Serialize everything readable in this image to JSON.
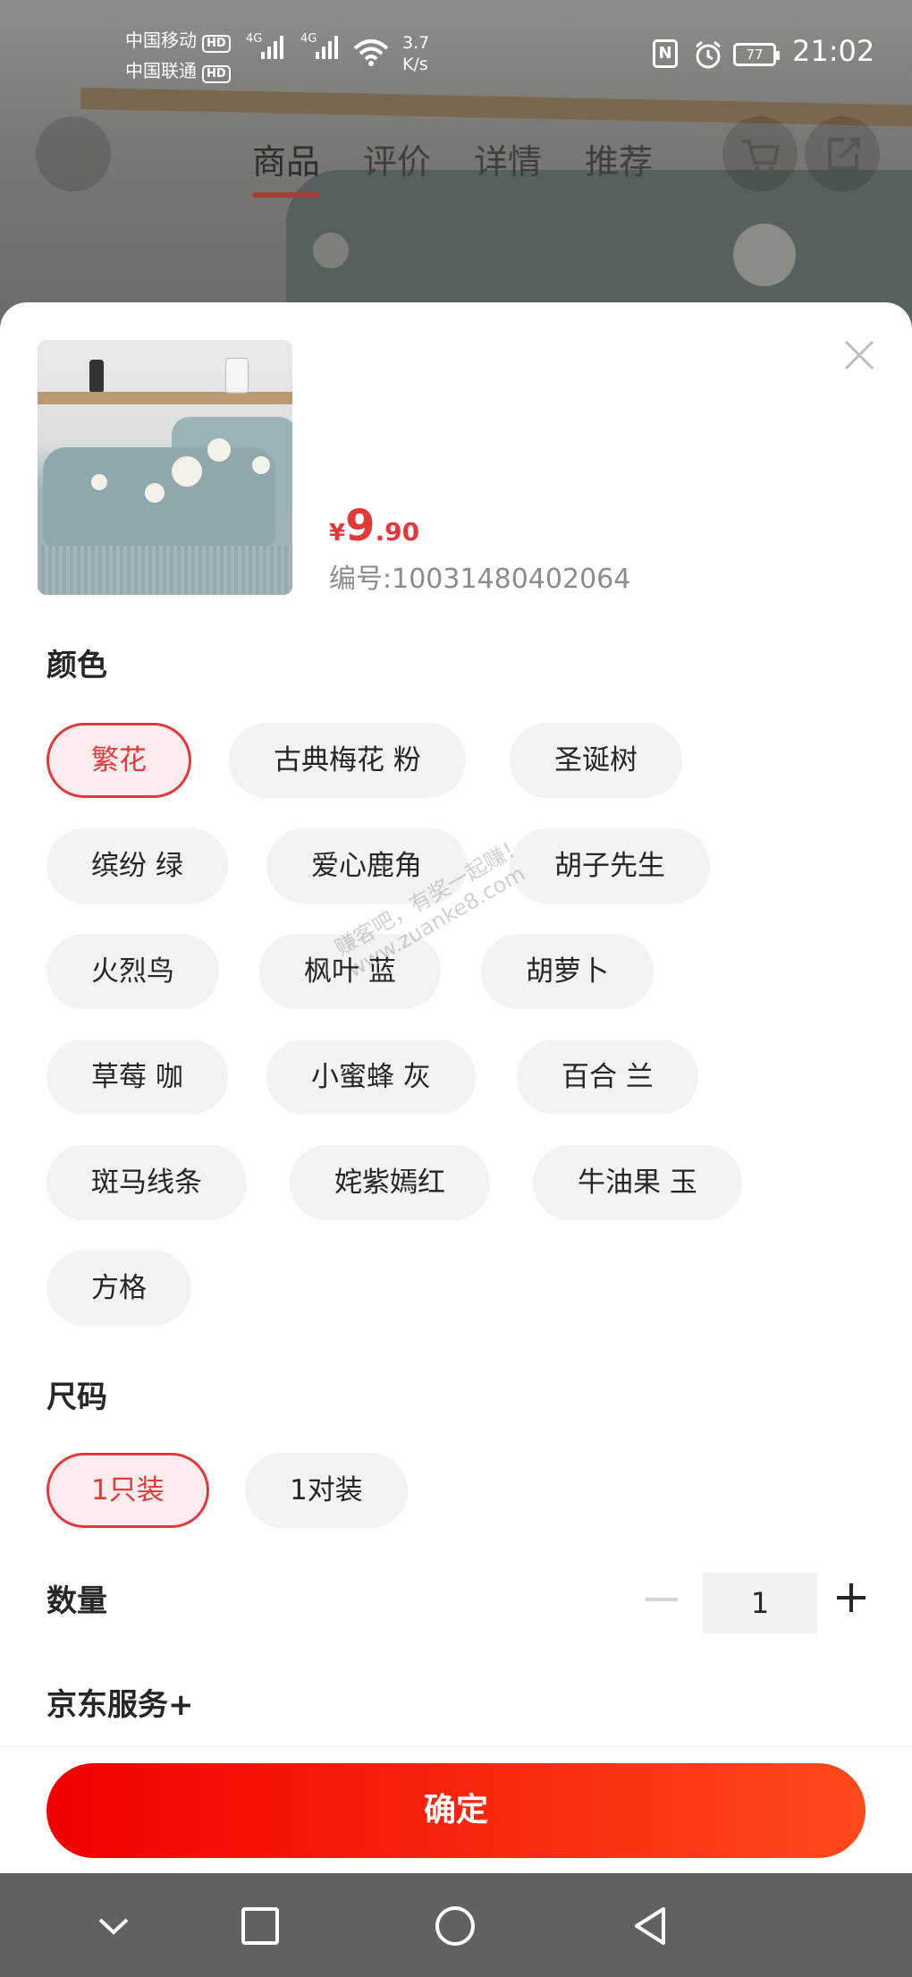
{
  "status_bar": {
    "carrier1": "中国移动",
    "carrier2": "中国联通",
    "hd_badge": "HD",
    "network1": "4G",
    "network2": "4G",
    "speed_value": "3.7",
    "speed_unit": "K/s",
    "nfc": "N",
    "battery": "77",
    "time": "21:02"
  },
  "page_nav": {
    "tabs": [
      "商品",
      "评价",
      "详情",
      "推荐"
    ],
    "active_tab": "商品"
  },
  "product": {
    "price_currency": "¥",
    "price_integer": "9",
    "price_decimal": ".90",
    "sku": "编号:10031480402064"
  },
  "color_section": {
    "title": "颜色",
    "options": [
      "繁花",
      "古典梅花 粉",
      "圣诞树",
      "缤纷 绿",
      "爱心鹿角",
      "胡子先生",
      "火烈鸟",
      "枫叶 蓝",
      "胡萝卜",
      "草莓 咖",
      "小蜜蜂 灰",
      "百合 兰",
      "斑马线条",
      "姹紫嫣红",
      "牛油果 玉",
      "方格"
    ],
    "selected": "繁花"
  },
  "size_section": {
    "title": "尺码",
    "options": [
      "1只装",
      "1对装"
    ],
    "selected": "1只装"
  },
  "quantity": {
    "title": "数量",
    "value": "1"
  },
  "service": {
    "title": "京东服务+"
  },
  "confirm_button": "确定",
  "watermark": {
    "line1": "赚客吧，有奖一起赚！",
    "line2": "www.zuanke8.com"
  },
  "colors": {
    "accent": "#e4393c",
    "button_start": "#f10000",
    "button_end": "#ff4a1a",
    "chip_bg": "#f3f3f3"
  },
  "icons": {
    "close": "close-icon",
    "back": "back-arrow-icon",
    "cart": "cart-icon",
    "share": "share-icon"
  }
}
